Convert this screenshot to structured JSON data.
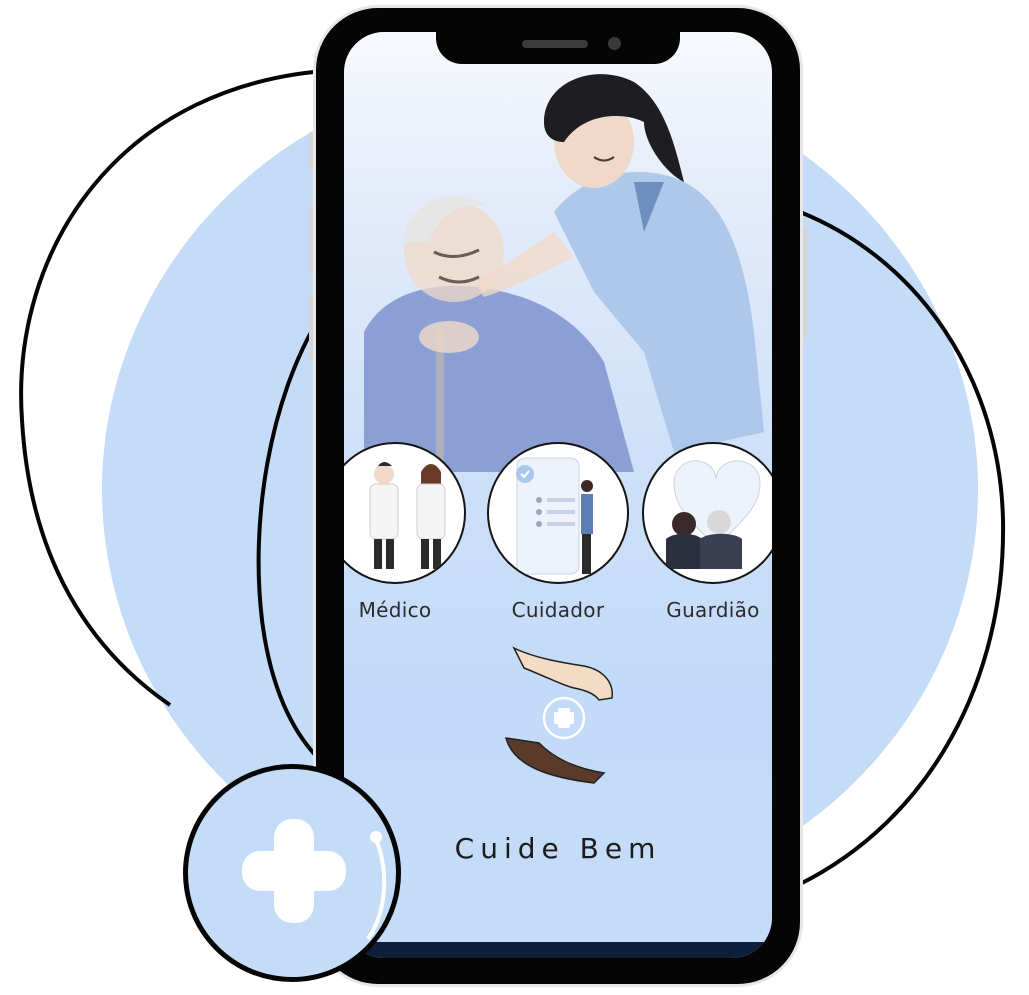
{
  "app": {
    "brand_name": "Cuide Bem"
  },
  "roles": [
    {
      "label": "Médico",
      "icon": "doctors-illustration"
    },
    {
      "label": "Cuidador",
      "icon": "caregiver-checklist-illustration"
    },
    {
      "label": "Guardião",
      "icon": "guardian-hug-illustration"
    }
  ],
  "colors": {
    "background_blob": "#c4dcf8",
    "phone_frame": "#050505",
    "screen_bottom": "#0d1f3a"
  },
  "icons": {
    "hero": "caregiver-with-elderly-illustration",
    "logo": "caring-hands-plus-icon",
    "badge": "plus-badge-icon"
  }
}
